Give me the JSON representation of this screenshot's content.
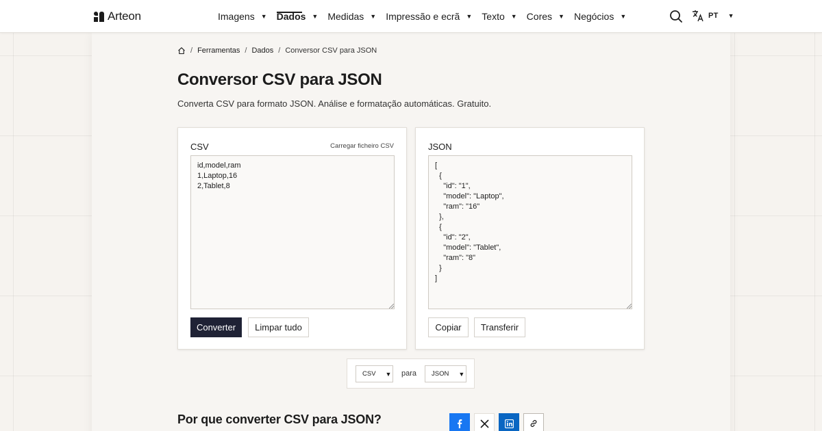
{
  "header": {
    "brand": "Arteon",
    "nav": [
      {
        "label": "Imagens"
      },
      {
        "label": "Dados"
      },
      {
        "label": "Medidas"
      },
      {
        "label": "Impressão e ecrã"
      },
      {
        "label": "Texto"
      },
      {
        "label": "Cores"
      },
      {
        "label": "Negócios"
      }
    ],
    "active_nav": "Dados",
    "language": "PT",
    "icons": {
      "search": "search-icon",
      "language": "translate-icon",
      "home": "home-icon"
    }
  },
  "breadcrumb": [
    "Ferramentas",
    "Dados",
    "Conversor CSV para JSON"
  ],
  "page": {
    "title": "Conversor CSV para JSON",
    "subtitle": "Converta CSV para formato JSON. Análise e formatação automáticas. Gratuito."
  },
  "input_panel": {
    "label": "CSV",
    "upload_link": "Carregar ficheiro CSV",
    "value": "id,model,ram\n1,Laptop,16\n2,Tablet,8",
    "convert_button": "Converter",
    "clear_button": "Limpar tudo"
  },
  "output_panel": {
    "label": "JSON",
    "value": "[\n  {\n    \"id\": \"1\",\n    \"model\": \"Laptop\",\n    \"ram\": \"16\"\n  },\n  {\n    \"id\": \"2\",\n    \"model\": \"Tablet\",\n    \"ram\": \"8\"\n  }\n]",
    "copy_button": "Copiar",
    "download_button": "Transferir"
  },
  "format_selector": {
    "from": "CSV",
    "connector": "para",
    "to": "JSON"
  },
  "section": {
    "title": "Por que converter CSV para JSON?"
  },
  "share": {
    "icons": [
      "facebook-icon",
      "x-icon",
      "linkedin-icon",
      "link-icon"
    ]
  },
  "colors": {
    "primary_button": "#1f2235",
    "facebook": "#1877f2",
    "linkedin": "#0a66c2",
    "background": "#f6f3ef"
  }
}
